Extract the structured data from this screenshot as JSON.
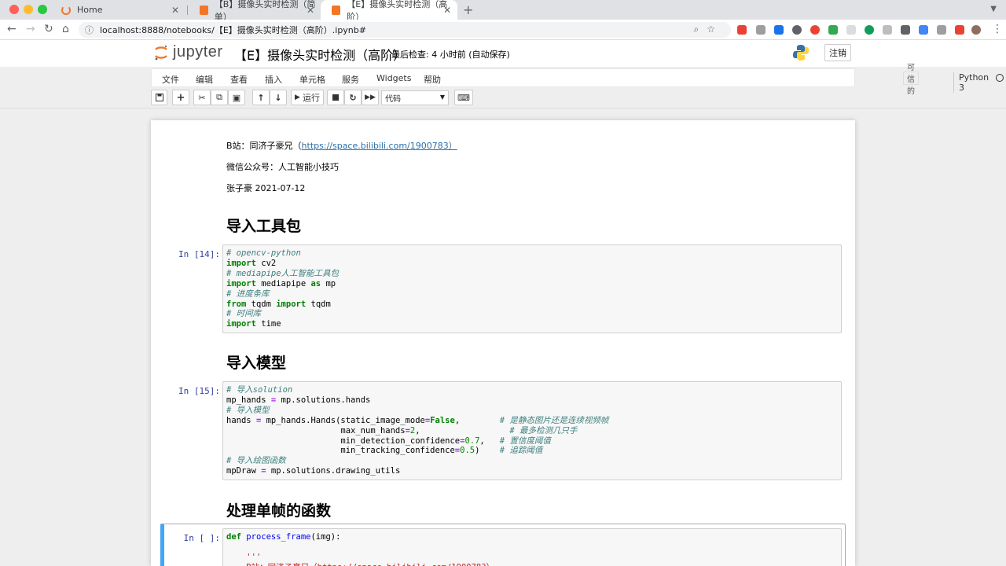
{
  "browser": {
    "tabs": [
      {
        "title": "Home",
        "active": false
      },
      {
        "title": "【B】摄像头实时检测（简单）",
        "active": false
      },
      {
        "title": "【E】摄像头实时检测（高阶）",
        "active": true
      }
    ],
    "new_tab": "+",
    "url": "localhost:8888/notebooks/【E】摄像头实时检测（高阶）.ipynb#"
  },
  "jupyter": {
    "logo_text": "jupyter",
    "notebook_title": "【E】摄像头实时检测（高阶）",
    "last_saved": "最后检查: 4 小时前  (自动保存)",
    "logout_label": "注销",
    "menu": [
      "文件",
      "编辑",
      "查看",
      "插入",
      "单元格",
      "服务",
      "Widgets",
      "帮助"
    ],
    "trusted_label": "可信的",
    "kernel_name": "Python 3",
    "run_label": "运行",
    "cell_type": "代码"
  },
  "notebook": {
    "intro_bilibili_label": "B站：同济子豪兄（",
    "intro_bilibili_link": "https://space.bilibili.com/1900783）",
    "intro_wechat": "微信公众号：人工智能小技巧",
    "intro_author": "张子豪 2021-07-12",
    "h_import": "导入工具包",
    "h_model": "导入模型",
    "h_process": "处理单帧的函数",
    "cell1_prompt": "In [14]:",
    "cell2_prompt": "In [15]:",
    "cell3_prompt": "In [ ]:"
  }
}
